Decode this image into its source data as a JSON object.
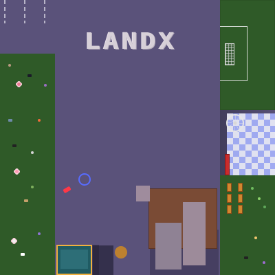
{
  "app": {
    "name": "Landx"
  },
  "map": {
    "logo_text": "LANDX"
  },
  "colors": {
    "background": "#5a527a",
    "grass": "#2f5a28",
    "logo_text": "#d7d0d8",
    "player_ring": "#586cff",
    "player_marker": "#ff3847",
    "building": "#7a4b35",
    "stage": "#1f5b63",
    "stage_border": "#f0b13f",
    "bench": "#c92c2c",
    "checker_blue": "#a8b4ff",
    "checker_white": "#f0f2ff"
  },
  "icons": {
    "player": "player-cursor-icon",
    "ferris_wheel": "ferris-wheel-icon",
    "goal": "goal-net-icon"
  }
}
